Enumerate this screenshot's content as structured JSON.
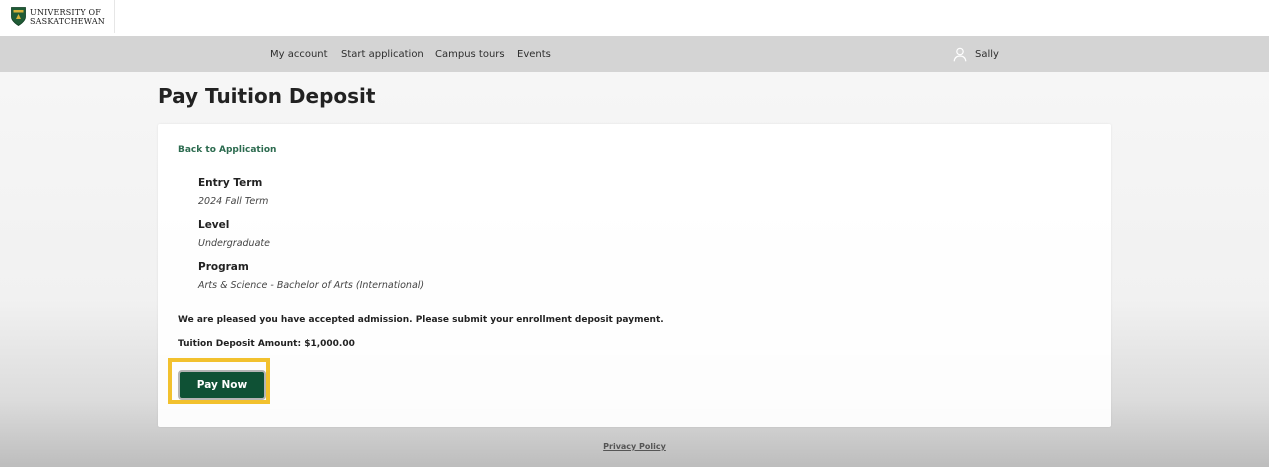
{
  "brand": {
    "logo_line1": "UNIVERSITY OF",
    "logo_line2": "SASKATCHEWAN",
    "logo_icon": "university-crest-icon",
    "shield_color": "#1f5b36"
  },
  "nav": {
    "items": [
      {
        "label": "My account"
      },
      {
        "label": "Start application"
      },
      {
        "label": "Campus tours"
      },
      {
        "label": "Events"
      }
    ],
    "user": {
      "icon": "user-icon",
      "name": "Sally"
    }
  },
  "page": {
    "title": "Pay Tuition Deposit"
  },
  "card": {
    "back_link": "Back to Application",
    "fields": [
      {
        "label": "Entry Term",
        "value": "2024 Fall Term"
      },
      {
        "label": "Level",
        "value": "Undergraduate"
      },
      {
        "label": "Program",
        "value": "Arts & Science - Bachelor of Arts (International)"
      }
    ],
    "message": "We are pleased you have accepted admission. Please submit your enrollment deposit payment.",
    "amount": "Tuition Deposit Amount: $1,000.00",
    "pay_button": "Pay Now"
  },
  "footer": {
    "privacy": "Privacy Policy"
  },
  "colors": {
    "accent_green": "#0f5135",
    "link_green": "#2c6b4f",
    "highlight": "#f2c12e",
    "nav_bg": "#d4d4d4"
  }
}
